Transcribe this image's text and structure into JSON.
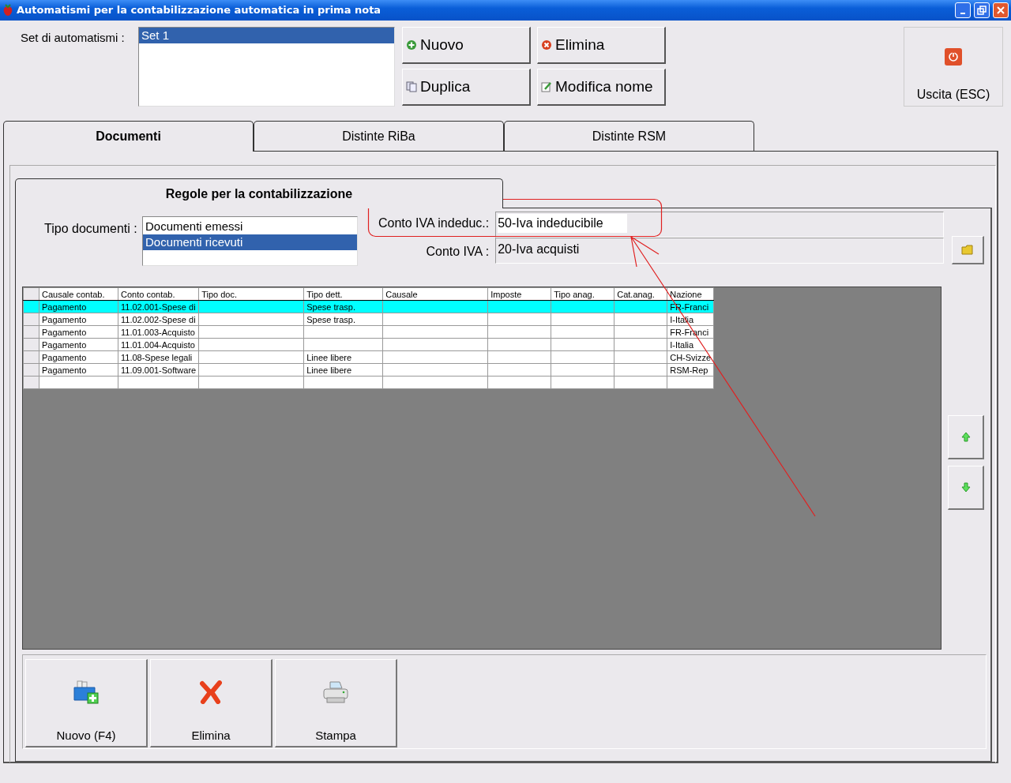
{
  "window": {
    "title": "Automatismi per la contabilizzazione automatica in prima nota"
  },
  "sets": {
    "label": "Set di automatismi :",
    "items": [
      {
        "label": "Set 1",
        "selected": true
      }
    ]
  },
  "set_buttons": [
    {
      "label": "Nuovo",
      "kind": "new"
    },
    {
      "label": "Elimina",
      "kind": "delete"
    },
    {
      "label": "Duplica",
      "kind": "duplicate"
    },
    {
      "label": "Modifica nome",
      "kind": "rename"
    }
  ],
  "exit_button": {
    "label": "Uscita (ESC)"
  },
  "tabs": [
    {
      "label": "Documenti",
      "selected": true
    },
    {
      "label": "Distinte RiBa",
      "selected": false
    },
    {
      "label": "Distinte RSM",
      "selected": false
    }
  ],
  "section_tab": {
    "label": "Regole per la contabilizzazione"
  },
  "document_types": {
    "label": "Tipo documenti :",
    "items": [
      {
        "label": "Documenti emessi",
        "selected": false
      },
      {
        "label": "Documenti ricevuti",
        "selected": true
      }
    ]
  },
  "accounts": [
    {
      "label": "Conto IVA indeduc.:",
      "value": "50-Iva indeducibile",
      "highlighted": true
    },
    {
      "label": "Conto IVA :",
      "value": "20-Iva acquisti",
      "highlighted": false
    }
  ],
  "table": {
    "columns": [
      "Causale contab.",
      "Conto contab.",
      "Tipo doc.",
      "Tipo dett.",
      "Causale",
      "Imposte",
      "Tipo anag.",
      "Cat.anag.",
      "Nazione"
    ],
    "rows": [
      {
        "selected": true,
        "cells": [
          "Pagamento",
          "11.02.001-Spese di",
          null,
          "Spese trasp.",
          null,
          null,
          null,
          null,
          "FR-Franci"
        ]
      },
      {
        "selected": false,
        "cells": [
          "Pagamento",
          "11.02.002-Spese di",
          null,
          "Spese trasp.",
          null,
          null,
          null,
          null,
          "I-Italia"
        ]
      },
      {
        "selected": false,
        "cells": [
          "Pagamento",
          "11.01.003-Acquisto",
          null,
          null,
          null,
          null,
          null,
          null,
          "FR-Franci"
        ]
      },
      {
        "selected": false,
        "cells": [
          "Pagamento",
          "11.01.004-Acquisto",
          null,
          null,
          null,
          null,
          null,
          null,
          "I-Italia"
        ]
      },
      {
        "selected": false,
        "cells": [
          "Pagamento",
          "11.08-Spese legali",
          null,
          "Linee libere",
          null,
          null,
          null,
          null,
          "CH-Svizze"
        ]
      },
      {
        "selected": false,
        "cells": [
          "Pagamento",
          "11.09.001-Software",
          null,
          "Linee libere",
          null,
          null,
          null,
          null,
          "RSM-Rep"
        ]
      }
    ]
  },
  "bottom_buttons": [
    {
      "label": "Nuovo (F4)",
      "kind": "new"
    },
    {
      "label": "Elimina",
      "kind": "delete"
    },
    {
      "label": "Stampa",
      "kind": "print"
    }
  ]
}
